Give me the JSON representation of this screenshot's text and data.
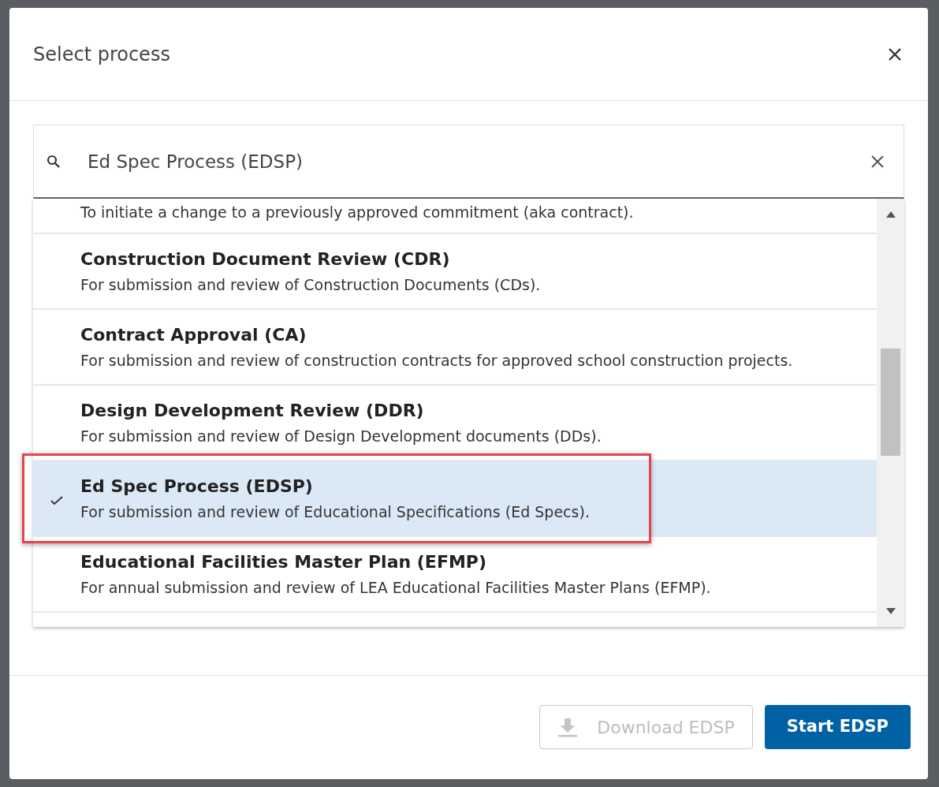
{
  "dialog": {
    "title": "Select process"
  },
  "search": {
    "value": "Ed Spec Process (EDSP)"
  },
  "processes": [
    {
      "description": "To initiate a change to a previously approved commitment (aka contract).",
      "selected": false,
      "annotated": false
    },
    {
      "name": "Construction Document Review (CDR)",
      "description": "For submission and review of Construction Documents (CDs).",
      "selected": false,
      "annotated": false
    },
    {
      "name": "Contract Approval (CA)",
      "description": "For submission and review of construction contracts for approved school construction projects.",
      "selected": false,
      "annotated": false
    },
    {
      "name": "Design Development Review (DDR)",
      "description": "For submission and review of Design Development documents (DDs).",
      "selected": false,
      "annotated": false
    },
    {
      "name": "Ed Spec Process (EDSP)",
      "description": "For submission and review of Educational Specifications (Ed Specs).",
      "selected": true,
      "annotated": true
    },
    {
      "name": "Educational Facilities Master Plan (EFMP)",
      "description": "For annual submission and review of LEA Educational Facilities Master Plans (EFMP).",
      "selected": false,
      "annotated": false
    }
  ],
  "buttons": [
    {
      "label": "Download EDSP",
      "kind": "secondary",
      "disabled": true
    },
    {
      "label": "Start EDSP",
      "kind": "primary",
      "disabled": false
    }
  ]
}
